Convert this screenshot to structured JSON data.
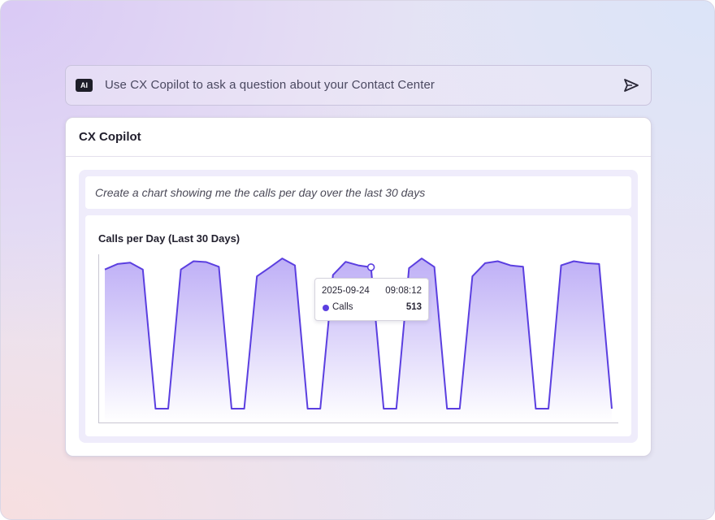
{
  "ask_bar": {
    "badge": "AI",
    "placeholder": "Use CX Copilot to ask a question about your Contact Center",
    "send_icon": "send-icon"
  },
  "panel": {
    "title": "CX Copilot",
    "prompt": "Create a chart showing me the calls per day over the last 30 days"
  },
  "colors": {
    "accent": "#5b3fe0",
    "area_top": "#b7a6f5",
    "area_bottom": "#ffffff"
  },
  "tooltip": {
    "date": "2025-09-24",
    "time": "09:08:12",
    "series": "Calls",
    "value": "513"
  },
  "chart_data": {
    "type": "area",
    "title": "Calls per Day (Last 30 Days)",
    "xlabel": "",
    "ylabel": "",
    "grid": false,
    "highlight_index": 21,
    "series": [
      {
        "name": "Calls",
        "values": [
          505,
          525,
          530,
          505,
          0,
          0,
          505,
          535,
          532,
          515,
          0,
          0,
          480,
          512,
          545,
          520,
          0,
          0,
          485,
          533,
          520,
          513,
          0,
          0,
          510,
          545,
          514,
          0,
          0,
          480,
          528,
          535,
          520,
          515,
          0,
          0,
          520,
          535,
          528,
          525,
          0
        ]
      }
    ],
    "ylim": [
      0,
      560
    ]
  }
}
